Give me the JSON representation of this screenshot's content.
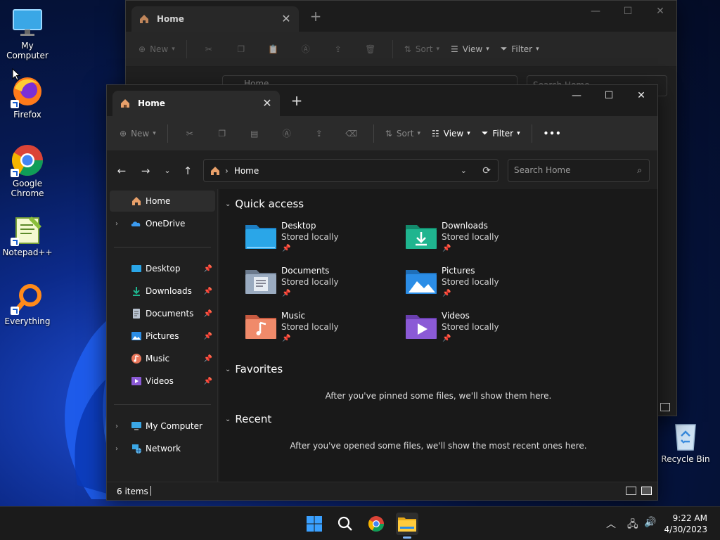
{
  "desktop": {
    "icons": [
      {
        "label": "My Computer"
      },
      {
        "label": "Firefox"
      },
      {
        "label": "Google Chrome"
      },
      {
        "label": "Notepad++"
      },
      {
        "label": "Everything"
      },
      {
        "label": "Recycle Bin"
      }
    ]
  },
  "back_window": {
    "tab_title": "Home",
    "toolbar": {
      "new": "New",
      "sort": "Sort",
      "view": "View",
      "filter": "Filter"
    },
    "address": "Home",
    "search_placeholder": "Search Home"
  },
  "window": {
    "tab_title": "Home",
    "toolbar": {
      "new": "New",
      "sort": "Sort",
      "view": "View",
      "filter": "Filter",
      "more": "•••"
    },
    "address": {
      "crumb": "Home"
    },
    "search": {
      "placeholder": "Search Home"
    },
    "sidebar": {
      "home": "Home",
      "onedrive": "OneDrive",
      "pinned": [
        {
          "label": "Desktop"
        },
        {
          "label": "Downloads"
        },
        {
          "label": "Documents"
        },
        {
          "label": "Pictures"
        },
        {
          "label": "Music"
        },
        {
          "label": "Videos"
        }
      ],
      "my_computer": "My Computer",
      "network": "Network"
    },
    "content": {
      "quick_access": {
        "title": "Quick access",
        "items": [
          {
            "name": "Desktop",
            "sub": "Stored locally",
            "color": "#2aa6e8"
          },
          {
            "name": "Downloads",
            "sub": "Stored locally",
            "color": "#1fb58f"
          },
          {
            "name": "Documents",
            "sub": "Stored locally",
            "color": "#8a9bb0"
          },
          {
            "name": "Pictures",
            "sub": "Stored locally",
            "color": "#2b8de6"
          },
          {
            "name": "Music",
            "sub": "Stored locally",
            "color": "#e8765a"
          },
          {
            "name": "Videos",
            "sub": "Stored locally",
            "color": "#8b5ad6"
          }
        ]
      },
      "favorites": {
        "title": "Favorites",
        "empty": "After you've pinned some files, we'll show them here."
      },
      "recent": {
        "title": "Recent",
        "empty": "After you've opened some files, we'll show the most recent ones here."
      }
    },
    "status": {
      "count": "6 items"
    }
  },
  "taskbar": {
    "time": "9:22 AM",
    "date": "4/30/2023"
  },
  "colors": {
    "accent": "#7fb3f5",
    "window_bg": "#202020",
    "content_bg": "#191919"
  }
}
